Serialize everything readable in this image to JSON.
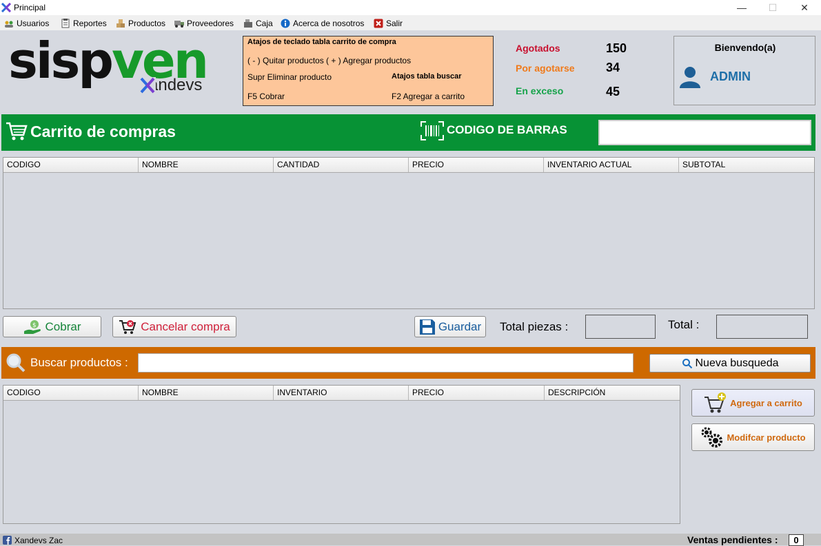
{
  "window": {
    "title": "Principal",
    "minimize": "—",
    "maximize": "☐",
    "close": "✕"
  },
  "menu": [
    {
      "label": "Usuarios"
    },
    {
      "label": "Reportes"
    },
    {
      "label": "Productos"
    },
    {
      "label": "Proveedores"
    },
    {
      "label": "Caja"
    },
    {
      "label": "Acerca de nosotros"
    },
    {
      "label": "Salir"
    }
  ],
  "logo": {
    "main_a": "sisp",
    "main_b": "ven",
    "sub": "xandevs"
  },
  "shortcuts": {
    "title": "Atajos de teclado tabla carrito de compra",
    "line1": "( - ) Quitar productos   ( + ) Agregar productos",
    "line2": "Supr Eliminar producto",
    "line3": "F5 Cobrar",
    "search_title": "Atajos tabla buscar",
    "search_line": "F2 Agregar a carrito"
  },
  "stats": {
    "agotados_label": "Agotados",
    "agotados_value": "150",
    "por_agotarse_label": "Por agotarse",
    "por_agotarse_value": "34",
    "exceso_label": "En exceso",
    "exceso_value": "45"
  },
  "welcome": {
    "title": "Bienvendo(a)",
    "user": "ADMIN"
  },
  "cart": {
    "title": "Carrito de compras",
    "barcode_label": "CODIGO DE BARRAS",
    "barcode_value": "",
    "columns": [
      "CODIGO",
      "NOMBRE",
      "CANTIDAD",
      "PRECIO",
      "INVENTARIO ACTUAL",
      "SUBTOTAL"
    ],
    "rows": []
  },
  "actions": {
    "cobrar": "Cobrar",
    "cancelar": "Cancelar compra",
    "guardar": "Guardar",
    "total_piezas_label": "Total piezas :",
    "total_piezas_value": "",
    "total_label": "Total :",
    "total_value": ""
  },
  "search": {
    "label": "Buscar productos :",
    "value": "",
    "button": "Nueva busqueda",
    "columns": [
      "CODIGO",
      "NOMBRE",
      "INVENTARIO",
      "PRECIO",
      "DESCRIPCIÓN"
    ],
    "rows": []
  },
  "side_buttons": {
    "agregar": "Agregar a carrito",
    "modificar": "Modifcar producto"
  },
  "status": {
    "left": "Xandevs Zac",
    "pending_label": "Ventas pendientes :",
    "pending_value": "0"
  },
  "colors": {
    "green": "#079235",
    "orange": "#ce6900",
    "red_stat": "#c8102e",
    "orange_stat": "#f07a1a",
    "green_stat": "#16a34a",
    "admin_blue": "#1e6fa8"
  }
}
